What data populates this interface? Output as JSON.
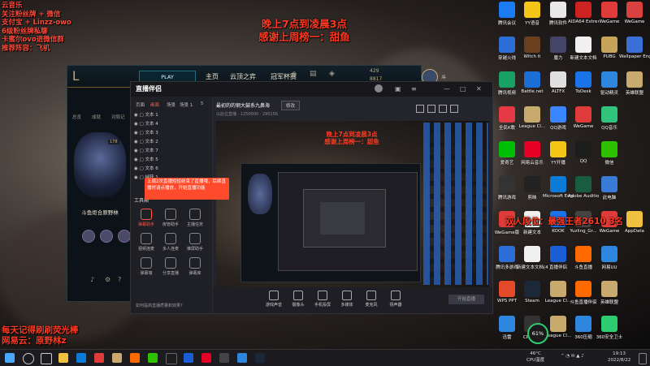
{
  "overlay": {
    "top_left_lines": [
      "云音乐 ",
      "关注粉丝牌 + 微信",
      "支付宝 + Linzz-owo",
      "6级粉丝牌私聊",
      "卡蜜尔ovo进微信群",
      "推荐阵容：飞机"
    ],
    "top_center_lines": [
      "晚上7点到凌晨3点",
      "感谢上周榜一：甜鱼"
    ],
    "rank_text": "双人段位：最强王者2610 3名",
    "bottom_left_lines": [
      "每天记得刷刷荧光棒",
      "网易云：原野林z"
    ]
  },
  "game_client": {
    "play_label": "PLAY",
    "nav": [
      "主页",
      "云顶之弈",
      "冠军杯赛"
    ],
    "sidebar_tabs": [
      "总览",
      "成就",
      "对局记"
    ],
    "player_name": "斗鱼炬合原野林",
    "level": "178",
    "header_name": "斗鱼炬合原野林",
    "currency": [
      "429",
      "8817"
    ]
  },
  "stream_app": {
    "brand": "直播伴侣",
    "tabs": [
      "页面",
      "画面",
      "场景",
      "场景 1",
      "5"
    ],
    "scene_items": [
      "文本 1",
      "文本 4",
      "文本 3",
      "文本 2",
      "文本 7",
      "文本 5",
      "文本 6",
      "捕获 1"
    ],
    "tools_title": "工具箱",
    "tools": [
      "弹幕助手",
      "房管助手",
      "主播任务",
      "视频连麦",
      "多人连麦",
      "推屏助手",
      "弹幕墙",
      "分享直播",
      "弹幕库",
      "下载",
      "设置",
      "粉丝团"
    ],
    "popup_text": "上周2次直播短短结束了直播哦，后续直播时请点播放，开始直播功能",
    "room_title": "最初的的钢大鼓系九鼻海",
    "edit_button": "修改",
    "meta": [
      "以此位直播",
      "1250000",
      "290156"
    ],
    "bottom_buttons": [
      "游戏声音",
      "摄像头",
      "手机投屏",
      "多媒体",
      "麦克风",
      "扬声器"
    ],
    "go_live": "开始直播",
    "status_text": "如何提高直播质量和效果？"
  },
  "desktop_icons": [
    {
      "label": "腾讯会议",
      "color": "#1a7cf0",
      "col": 0,
      "row": 0
    },
    {
      "label": "YY语音",
      "color": "#f5c518",
      "col": 1,
      "row": 0
    },
    {
      "label": "腾讯软件",
      "color": "#e8e8e8",
      "col": 2,
      "row": 0
    },
    {
      "label": "AIDA64 Extreme",
      "color": "#cc2222",
      "col": 3,
      "row": 0
    },
    {
      "label": "WeGame",
      "color": "#e03b3b",
      "col": 4,
      "row": 0
    },
    {
      "label": "WeGame",
      "color": "#d94040",
      "col": 5,
      "row": 0
    },
    {
      "label": "穿越火线",
      "color": "#2b6fd6",
      "col": 0,
      "row": 1
    },
    {
      "label": "Witch it",
      "color": "#6a3f1f",
      "col": 1,
      "row": 1
    },
    {
      "label": "魔力",
      "color": "#444466",
      "col": 2,
      "row": 1
    },
    {
      "label": "新建文本文档",
      "color": "#f0f0f0",
      "col": 3,
      "row": 1
    },
    {
      "label": "PUBG",
      "color": "#c8a35a",
      "col": 4,
      "row": 1
    },
    {
      "label": "Wallpaper Engine",
      "color": "#3a6fd8",
      "col": 5,
      "row": 1
    },
    {
      "label": "腾讯视频",
      "color": "#1aa064",
      "col": 0,
      "row": 2
    },
    {
      "label": "Battle.net",
      "color": "#1c6ed6",
      "col": 1,
      "row": 2
    },
    {
      "label": "ALTFX",
      "color": "#e0e0e0",
      "col": 2,
      "row": 2
    },
    {
      "label": "ToDesk",
      "color": "#1a73e8",
      "col": 3,
      "row": 2
    },
    {
      "label": "驱动精灵",
      "color": "#2e86de",
      "col": 4,
      "row": 2
    },
    {
      "label": "英雄联盟",
      "color": "#c8aa6e",
      "col": 5,
      "row": 2
    },
    {
      "label": "全民K歌",
      "color": "#e63946",
      "col": 0,
      "row": 3
    },
    {
      "label": "League Cl...",
      "color": "#c8aa6e",
      "col": 1,
      "row": 3
    },
    {
      "label": "QQ游戏",
      "color": "#3a86ff",
      "col": 2,
      "row": 3
    },
    {
      "label": "WeGame",
      "color": "#e03b3b",
      "col": 3,
      "row": 3
    },
    {
      "label": "QQ音乐",
      "color": "#31c27c",
      "col": 4,
      "row": 3
    },
    {
      "label": "爱奇艺",
      "color": "#00be06",
      "col": 0,
      "row": 4
    },
    {
      "label": "网易云音乐",
      "color": "#e60026",
      "col": 1,
      "row": 4
    },
    {
      "label": "YY开播",
      "color": "#f5c518",
      "col": 2,
      "row": 4
    },
    {
      "label": "QQ",
      "color": "#1d1d1d",
      "col": 3,
      "row": 4
    },
    {
      "label": "微信",
      "color": "#2dc100",
      "col": 4,
      "row": 4
    },
    {
      "label": "腾讯游戏",
      "color": "#333",
      "col": 0,
      "row": 5
    },
    {
      "label": "剪映",
      "color": "#222",
      "col": 1,
      "row": 5
    },
    {
      "label": "Microsoft Edge",
      "color": "#0c7bd8",
      "col": 2,
      "row": 5
    },
    {
      "label": "Adobe Audition",
      "color": "#1a5c40",
      "col": 3,
      "row": 5
    },
    {
      "label": "此电脑",
      "color": "#3a7bd5",
      "col": 4,
      "row": 5
    },
    {
      "label": "WeGame版",
      "color": "#e03b3b",
      "col": 0,
      "row": 6
    },
    {
      "label": "新建文本",
      "color": "#f0f0f0",
      "col": 1,
      "row": 6
    },
    {
      "label": "KOOK",
      "color": "#1a73e8",
      "col": 2,
      "row": 6
    },
    {
      "label": "Yuzling_Gr...",
      "color": "#444",
      "col": 3,
      "row": 6
    },
    {
      "label": "WeGame",
      "color": "#e03b3b",
      "col": 4,
      "row": 6
    },
    {
      "label": "AppData",
      "color": "#f0c040",
      "col": 5,
      "row": 6
    },
    {
      "label": "腾讯多游戏",
      "color": "#2b6fd6",
      "col": 0,
      "row": 7
    },
    {
      "label": "新建文本文档(4)",
      "color": "#f0f0f0",
      "col": 1,
      "row": 7
    },
    {
      "label": "直播伴侣",
      "color": "#1a5fd8",
      "col": 2,
      "row": 7
    },
    {
      "label": "斗鱼直播",
      "color": "#ff6a00",
      "col": 3,
      "row": 7
    },
    {
      "label": "网易UU",
      "color": "#2e86de",
      "col": 4,
      "row": 7
    },
    {
      "label": "WPS PPT",
      "color": "#e24a2a",
      "col": 0,
      "row": 8
    },
    {
      "label": "Steam",
      "color": "#1b2838",
      "col": 1,
      "row": 8
    },
    {
      "label": "League Cl...",
      "color": "#c8aa6e",
      "col": 2,
      "row": 8
    },
    {
      "label": "斗鱼直播伴侣",
      "color": "#ff6a00",
      "col": 3,
      "row": 8
    },
    {
      "label": "英雄联盟",
      "color": "#c8aa6e",
      "col": 4,
      "row": 8
    },
    {
      "label": "迅雷",
      "color": "#2e86de",
      "col": 0,
      "row": 9
    },
    {
      "label": "CPU温度",
      "color": "#333",
      "col": 1,
      "row": 9
    },
    {
      "label": "League Cl...",
      "color": "#c8aa6e",
      "col": 2,
      "row": 9
    },
    {
      "label": "360压缩",
      "color": "#2e86de",
      "col": 3,
      "row": 9
    },
    {
      "label": "360安全卫士",
      "color": "#2ecc71",
      "col": 4,
      "row": 9
    }
  ],
  "gauge": {
    "value": "61%",
    "color": "#2ecc71"
  },
  "taskbar": {
    "temp": "46°C",
    "temp_sub": "CPU温度",
    "clock_time": "19:13",
    "clock_date": "2022/8/22"
  }
}
